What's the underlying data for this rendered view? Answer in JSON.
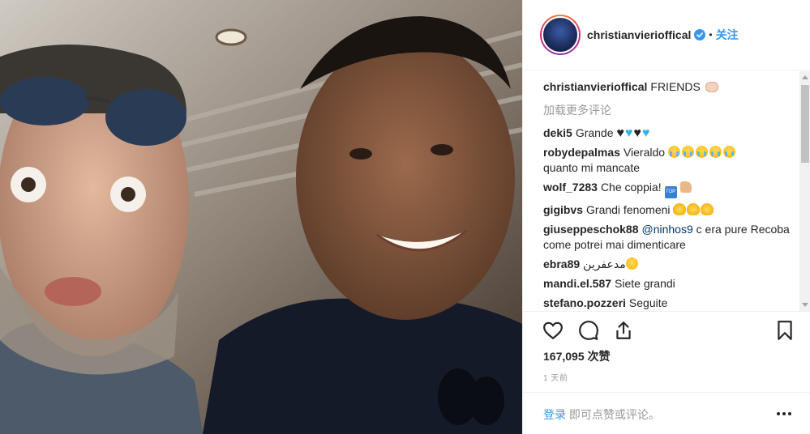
{
  "post": {
    "username": "christianvierioffical",
    "follow_label": "关注",
    "dot": "•",
    "caption": "FRIENDS",
    "load_more_label": "加载更多评论",
    "likes_label": "167,095 次赞",
    "time_label": "1 天前",
    "footer_login": "登录",
    "footer_rest": " 即可点赞或评论。"
  },
  "comments": [
    {
      "author": "deki5",
      "text": "Grande"
    },
    {
      "author": "robydepalmas",
      "text": "Vieraldo",
      "text2": "quanto mi mancate"
    },
    {
      "author": "wolf_7283",
      "text": "Che coppia!"
    },
    {
      "author": "gigibvs",
      "text": "Grandi fenomeni"
    },
    {
      "author": "giuseppeschok88",
      "mention": "@ninhos9",
      "text": " c era pure Recoba come potrei mai dimenticare"
    },
    {
      "author": "ebra89",
      "text": "مدعفرين"
    },
    {
      "author": "mandi.el.587",
      "text": "Siete grandi"
    },
    {
      "author": "stefano.pozzeri",
      "text": "Seguite"
    }
  ],
  "icons": {
    "heart": "heart-icon",
    "comment": "comment-icon",
    "share": "share-icon",
    "bookmark": "bookmark-icon",
    "verified": "verified-badge-icon",
    "more": "more-options-icon"
  },
  "colors": {
    "link_blue": "#3897f0",
    "muted": "#999999",
    "text": "#262626"
  }
}
